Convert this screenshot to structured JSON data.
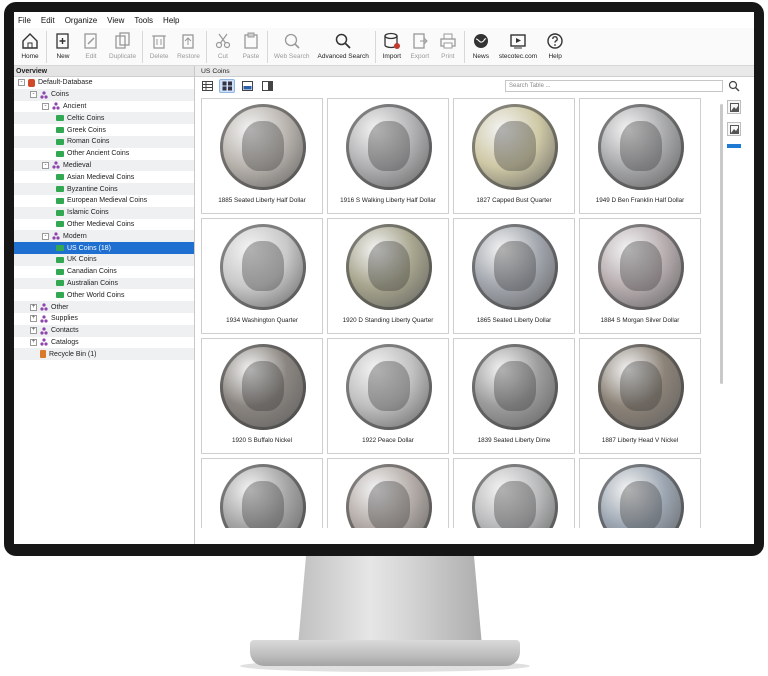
{
  "menu": [
    "File",
    "Edit",
    "Organize",
    "View",
    "Tools",
    "Help"
  ],
  "toolbar": [
    {
      "label": "Home",
      "icon": "home-icon",
      "enabled": true
    },
    {
      "label": "New",
      "icon": "new-icon",
      "enabled": true
    },
    {
      "label": "Edit",
      "icon": "edit-icon",
      "enabled": false
    },
    {
      "label": "Duplicate",
      "icon": "duplicate-icon",
      "enabled": false
    },
    {
      "label": "Delete",
      "icon": "delete-icon",
      "enabled": false
    },
    {
      "label": "Restore",
      "icon": "restore-icon",
      "enabled": false
    },
    {
      "label": "Cut",
      "icon": "cut-icon",
      "enabled": false
    },
    {
      "label": "Paste",
      "icon": "paste-icon",
      "enabled": false
    },
    {
      "label": "Web Search",
      "icon": "web-search-icon",
      "enabled": false
    },
    {
      "label": "Advanced Search",
      "icon": "advanced-search-icon",
      "enabled": true
    },
    {
      "label": "Import",
      "icon": "import-icon",
      "enabled": true
    },
    {
      "label": "Export",
      "icon": "export-icon",
      "enabled": false
    },
    {
      "label": "Print",
      "icon": "print-icon",
      "enabled": false
    },
    {
      "label": "News",
      "icon": "news-icon",
      "enabled": true
    },
    {
      "label": "stecotec.com",
      "icon": "video-icon",
      "enabled": true
    },
    {
      "label": "Help",
      "icon": "help-icon",
      "enabled": true
    }
  ],
  "overview": {
    "title": "Overview",
    "tree": [
      {
        "label": "Default-Database",
        "level": 0,
        "kind": "db",
        "exp": "-"
      },
      {
        "label": "Coins",
        "level": 1,
        "kind": "cat",
        "exp": "-"
      },
      {
        "label": "Ancient",
        "level": 2,
        "kind": "cat",
        "exp": "-"
      },
      {
        "label": "Celtic Coins",
        "level": 3,
        "kind": "folder"
      },
      {
        "label": "Greek Coins",
        "level": 3,
        "kind": "folder"
      },
      {
        "label": "Roman Coins",
        "level": 3,
        "kind": "folder"
      },
      {
        "label": "Other Ancient Coins",
        "level": 3,
        "kind": "folder"
      },
      {
        "label": "Medieval",
        "level": 2,
        "kind": "cat",
        "exp": "-"
      },
      {
        "label": "Asian Medieval Coins",
        "level": 3,
        "kind": "folder"
      },
      {
        "label": "Byzantine Coins",
        "level": 3,
        "kind": "folder"
      },
      {
        "label": "European Medieval Coins",
        "level": 3,
        "kind": "folder"
      },
      {
        "label": "Islamic Coins",
        "level": 3,
        "kind": "folder"
      },
      {
        "label": "Other Medieval Coins",
        "level": 3,
        "kind": "folder"
      },
      {
        "label": "Modern",
        "level": 2,
        "kind": "cat",
        "exp": "-"
      },
      {
        "label": "US Coins (18)",
        "level": 3,
        "kind": "folder",
        "selected": true
      },
      {
        "label": "UK Coins",
        "level": 3,
        "kind": "folder"
      },
      {
        "label": "Canadian Coins",
        "level": 3,
        "kind": "folder"
      },
      {
        "label": "Australian Coins",
        "level": 3,
        "kind": "folder"
      },
      {
        "label": "Other World Coins",
        "level": 3,
        "kind": "folder"
      },
      {
        "label": "Other",
        "level": 1,
        "kind": "cat",
        "exp": "+"
      },
      {
        "label": "Supplies",
        "level": 1,
        "kind": "cat",
        "exp": "+"
      },
      {
        "label": "Contacts",
        "level": 1,
        "kind": "cat",
        "exp": "+"
      },
      {
        "label": "Catalogs",
        "level": 1,
        "kind": "cat",
        "exp": "+"
      },
      {
        "label": "Recycle Bin (1)",
        "level": 1,
        "kind": "bin"
      }
    ]
  },
  "tab": "US Coins",
  "search_placeholder": "Search Table ...",
  "coins": [
    {
      "caption": "1885 Seated Liberty Half Dollar",
      "color": "#b9b4ae"
    },
    {
      "caption": "1916 S Walking Liberty Half Dollar",
      "color": "#b2b2b4"
    },
    {
      "caption": "1827 Capped Bust Quarter",
      "color": "#cfc9a6"
    },
    {
      "caption": "1949 D Ben Franklin Half Dollar",
      "color": "#a9aaac"
    },
    {
      "caption": "1934 Washington Quarter",
      "color": "#c9c9c9"
    },
    {
      "caption": "1920 D Standing Liberty Quarter",
      "color": "#a8a68e"
    },
    {
      "caption": "1865 Seated Liberty Dollar",
      "color": "#a2a6ad"
    },
    {
      "caption": "1884 S Morgan Silver Dollar",
      "color": "#b8aeb0"
    },
    {
      "caption": "1920 S Buffalo Nickel",
      "color": "#8a8580"
    },
    {
      "caption": "1922 Peace Dollar",
      "color": "#c0c0c0"
    },
    {
      "caption": "1839 Seated Liberty Dime",
      "color": "#9c9c9c"
    },
    {
      "caption": "1887 Liberty Head V Nickel",
      "color": "#8c8378"
    },
    {
      "caption": "",
      "color": "#a6a6a6"
    },
    {
      "caption": "",
      "color": "#b4aca8"
    },
    {
      "caption": "",
      "color": "#b9babb"
    },
    {
      "caption": "",
      "color": "#9ca6b2"
    }
  ]
}
